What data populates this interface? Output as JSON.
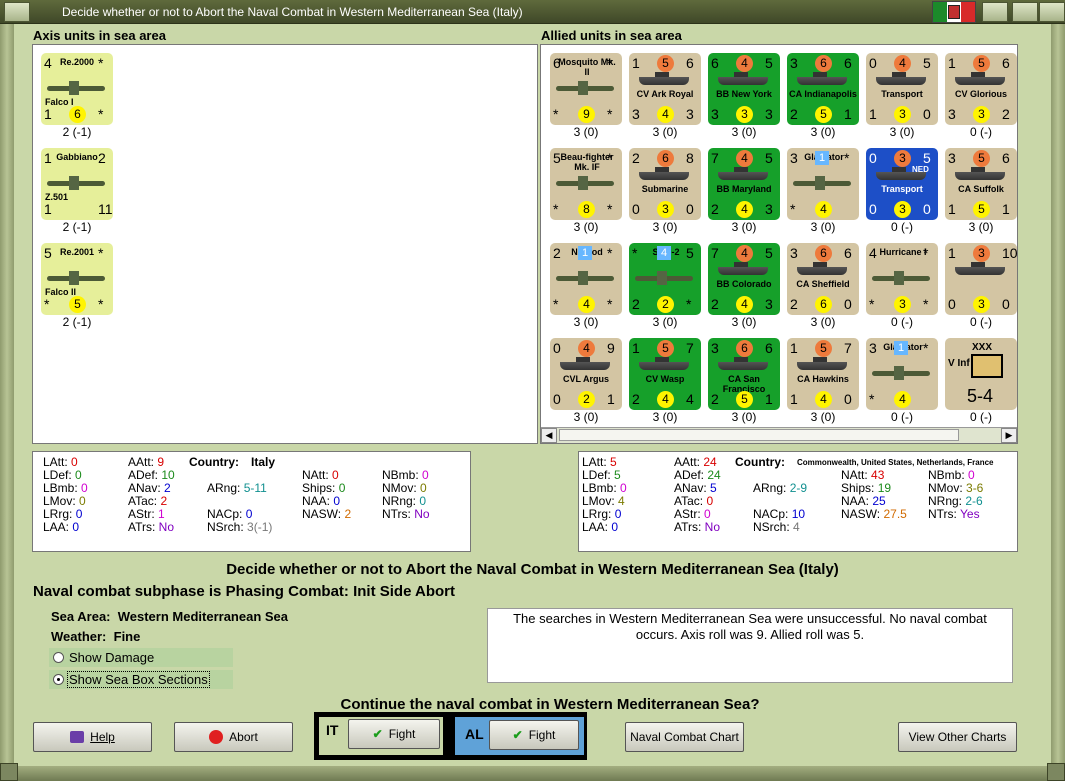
{
  "window": {
    "title": "Decide whether or not to Abort the Naval Combat in Western Mediterranean Sea (Italy)"
  },
  "axis_header": "Axis units in sea area",
  "allied_header": "Allied units in sea area",
  "axis_units": [
    {
      "name": "Re.2000",
      "sub": "Falco I",
      "tl": "4",
      "tr": "*",
      "bl": "1",
      "bc": "6",
      "br": "*",
      "label": "2 (-1)",
      "bg": "yel"
    },
    {
      "name": "Gabbiano",
      "sub": "Z.501",
      "tl": "1",
      "tr": "2",
      "bl": "1",
      "bc": "",
      "br": "11",
      "label": "2 (-1)",
      "bg": "yel"
    },
    {
      "name": "Re.2001",
      "sub": "Falco II",
      "tl": "5",
      "tr": "*",
      "bl": "*",
      "bc": "5",
      "br": "*",
      "label": "2 (-1)",
      "bg": "yel"
    }
  ],
  "allied_units": [
    {
      "name": "Mosquito Mk. II",
      "tl": "6",
      "tr": "*",
      "bl": "*",
      "bc": "9",
      "br": "*",
      "label": "3 (0)",
      "bg": "tan",
      "kind": "plane"
    },
    {
      "name": "CV Ark Royal",
      "tl": "1",
      "tc": "5",
      "tr": "6",
      "bl": "3",
      "bc": "4",
      "br": "3",
      "label": "3 (0)",
      "bg": "tan",
      "kind": "ship"
    },
    {
      "name": "BB New York",
      "tl": "6",
      "tc": "4",
      "tr": "5",
      "bl": "3",
      "bc": "3",
      "br": "3",
      "label": "3 (0)",
      "bg": "grn",
      "kind": "ship"
    },
    {
      "name": "CA Indianapolis",
      "tl": "3",
      "tc": "6",
      "tr": "6",
      "bl": "2",
      "bc": "5",
      "br": "1",
      "label": "3 (0)",
      "bg": "grn",
      "kind": "ship"
    },
    {
      "name": "Transport",
      "tl": "0",
      "tc": "4",
      "tr": "5",
      "bl": "1",
      "bc": "3",
      "br": "0",
      "label": "3 (0)",
      "bg": "tan",
      "kind": "ship"
    },
    {
      "name": "CV Glorious",
      "tl": "1",
      "tc": "5",
      "tr": "6",
      "bl": "3",
      "bc": "3",
      "br": "2",
      "label": "0 (-)",
      "bg": "tan",
      "kind": "ship"
    },
    {
      "name": "Beau-fighter Mk. IF",
      "tl": "5",
      "tr": "*",
      "bl": "*",
      "bc": "8",
      "br": "*",
      "label": "3 (0)",
      "bg": "tan",
      "kind": "plane"
    },
    {
      "name": "Submarine",
      "tl": "2",
      "tc": "6",
      "tr": "8",
      "bl": "0",
      "bc": "3",
      "br": "0",
      "label": "3 (0)",
      "bg": "tan",
      "kind": "ship"
    },
    {
      "name": "BB Maryland",
      "tl": "7",
      "tc": "4",
      "tr": "5",
      "bl": "2",
      "bc": "4",
      "br": "3",
      "label": "3 (0)",
      "bg": "grn",
      "kind": "ship"
    },
    {
      "name": "Gladiator",
      "tl": "3",
      "tc": "1",
      "tr": "*",
      "bl": "*",
      "bc": "4",
      "br": "",
      "label": "3 (0)",
      "bg": "tan",
      "kind": "plane"
    },
    {
      "name": "Transport",
      "tl": "0",
      "tc": "3",
      "tr": "5",
      "bl": "0",
      "bc": "3",
      "br": "0",
      "label": "0 (-)",
      "bg": "blu",
      "kind": "ship",
      "flag": "NED"
    },
    {
      "name": "CA Suffolk",
      "tl": "3",
      "tc": "5",
      "tr": "6",
      "bl": "1",
      "bc": "5",
      "br": "1",
      "label": "3 (0)",
      "bg": "tan",
      "kind": "ship"
    },
    {
      "name": "Nimrod",
      "tl": "2",
      "tc": "1",
      "tr": "*",
      "bl": "*",
      "bc": "4",
      "br": "*",
      "label": "3 (0)",
      "bg": "tan",
      "kind": "plane"
    },
    {
      "name": "SBD-2",
      "tl": "*",
      "tc": "4",
      "tr": "5",
      "bl": "2",
      "bc": "2",
      "br": "*",
      "label": "3 (0)",
      "bg": "grn",
      "kind": "plane"
    },
    {
      "name": "BB Colorado",
      "tl": "7",
      "tc": "4",
      "tr": "5",
      "bl": "2",
      "bc": "4",
      "br": "3",
      "label": "3 (0)",
      "bg": "grn",
      "kind": "ship"
    },
    {
      "name": "CA Sheffield",
      "tl": "3",
      "tc": "6",
      "tr": "6",
      "bl": "2",
      "bc": "6",
      "br": "0",
      "label": "3 (0)",
      "bg": "tan",
      "kind": "ship"
    },
    {
      "name": "Hurricane I",
      "tl": "4",
      "tr": "*",
      "bl": "*",
      "bc": "3",
      "br": "*",
      "label": "0 (-)",
      "bg": "tan",
      "kind": "plane"
    },
    {
      "name": "",
      "tl": "1",
      "tc": "3",
      "tr": "10",
      "bl": "0",
      "bc": "3",
      "br": "0",
      "label": "0 (-)",
      "bg": "tan",
      "kind": "ship"
    },
    {
      "name": "CVL Argus",
      "tl": "0",
      "tc": "4",
      "tr": "9",
      "bl": "0",
      "bc": "2",
      "br": "1",
      "label": "3 (0)",
      "bg": "tan",
      "kind": "ship"
    },
    {
      "name": "CV Wasp",
      "tl": "1",
      "tc": "5",
      "tr": "7",
      "bl": "2",
      "bc": "4",
      "br": "4",
      "label": "3 (0)",
      "bg": "grn",
      "kind": "ship"
    },
    {
      "name": "CA San Francisco",
      "tl": "3",
      "tc": "6",
      "tr": "6",
      "bl": "2",
      "bc": "5",
      "br": "1",
      "label": "3 (0)",
      "bg": "grn",
      "kind": "ship"
    },
    {
      "name": "CA Hawkins",
      "tl": "1",
      "tc": "5",
      "tr": "7",
      "bl": "1",
      "bc": "4",
      "br": "0",
      "label": "3 (0)",
      "bg": "tan",
      "kind": "ship"
    },
    {
      "name": "Gladiator",
      "tl": "3",
      "tc": "1",
      "tr": "*",
      "bl": "*",
      "bc": "4",
      "br": "",
      "label": "0 (-)",
      "bg": "tan",
      "kind": "plane"
    },
    {
      "name": "V Inf",
      "tl": "XXX",
      "tc": "",
      "tr": "",
      "bl": "",
      "bc": "5-4",
      "br": "",
      "label": "0 (-)",
      "bg": "tan",
      "kind": "army"
    }
  ],
  "axis_stats": {
    "country_label": "Country:",
    "country": "Italy",
    "col1": [
      [
        "LAtt:",
        "0"
      ],
      [
        "LDef:",
        "0"
      ],
      [
        "LBmb:",
        "0"
      ],
      [
        "LMov:",
        "0"
      ],
      [
        "LRrg:",
        "0"
      ],
      [
        "LAA:",
        "0"
      ]
    ],
    "col2": [
      [
        "AAtt:",
        "9"
      ],
      [
        "ADef:",
        "10"
      ],
      [
        "ANav:",
        "2"
      ],
      [
        "ATac:",
        "2"
      ],
      [
        "AStr:",
        "1"
      ],
      [
        "ATrs:",
        "No"
      ]
    ],
    "col3": [
      [
        "ARng:",
        "5-11"
      ],
      [
        "NACp:",
        "0"
      ],
      [
        "NSrch:",
        "3(-1)"
      ]
    ],
    "col4": [
      [
        "NAtt:",
        "0"
      ],
      [
        "Ships:",
        "0"
      ],
      [
        "NAA:",
        "0"
      ],
      [
        "NASW:",
        "2"
      ]
    ],
    "col5": [
      [
        "NBmb:",
        "0"
      ],
      [
        "NMov:",
        "0"
      ],
      [
        "NRng:",
        "0"
      ],
      [
        "NTrs:",
        "No"
      ]
    ]
  },
  "allied_stats": {
    "country_label": "Country:",
    "country": "Commonwealth, United States, Netherlands, France",
    "col1": [
      [
        "LAtt:",
        "5"
      ],
      [
        "LDef:",
        "5"
      ],
      [
        "LBmb:",
        "0"
      ],
      [
        "LMov:",
        "4"
      ],
      [
        "LRrg:",
        "0"
      ],
      [
        "LAA:",
        "0"
      ]
    ],
    "col2": [
      [
        "AAtt:",
        "24"
      ],
      [
        "ADef:",
        "24"
      ],
      [
        "ANav:",
        "5"
      ],
      [
        "ATac:",
        "0"
      ],
      [
        "AStr:",
        "0"
      ],
      [
        "ATrs:",
        "No"
      ]
    ],
    "col3": [
      [
        "ARng:",
        "2-9"
      ],
      [
        "NACp:",
        "10"
      ],
      [
        "NSrch:",
        "4"
      ]
    ],
    "col4": [
      [
        "NAtt:",
        "43"
      ],
      [
        "Ships:",
        "19"
      ],
      [
        "NAA:",
        "25"
      ],
      [
        "NASW:",
        "27.5"
      ]
    ],
    "col5": [
      [
        "NBmb:",
        "0"
      ],
      [
        "NMov:",
        "3-6"
      ],
      [
        "NRng:",
        "2-6"
      ],
      [
        "NTrs:",
        "Yes"
      ]
    ]
  },
  "main_heading": "Decide whether or not to Abort the Naval Combat in Western Mediterranean Sea (Italy)",
  "subphase": "Naval combat subphase is Phasing Combat: Init Side Abort",
  "sea_area_label": "Sea Area:",
  "sea_area": "Western Mediterranean Sea",
  "weather_label": "Weather:",
  "weather": "Fine",
  "opt_damage": "Show Damage",
  "opt_sections": "Show Sea Box Sections",
  "message": "The searches in Western Mediterranean Sea were unsuccessful.  No naval combat occurs.  Axis roll was 9.  Allied roll was 5.",
  "question": "Continue the naval combat in Western Mediterranean Sea?",
  "buttons": {
    "help": "Help",
    "abort": "Abort",
    "it_tag": "IT",
    "it_fight": "Fight",
    "al_tag": "AL",
    "al_fight": "Fight",
    "naval_chart": "Naval Combat Chart",
    "other_charts": "View Other Charts"
  },
  "colors": {
    "background": "#c9d7a8",
    "green_counter": "#16a02a",
    "tan_counter": "#d3c5a3",
    "axis_counter": "#e6ef9a"
  }
}
